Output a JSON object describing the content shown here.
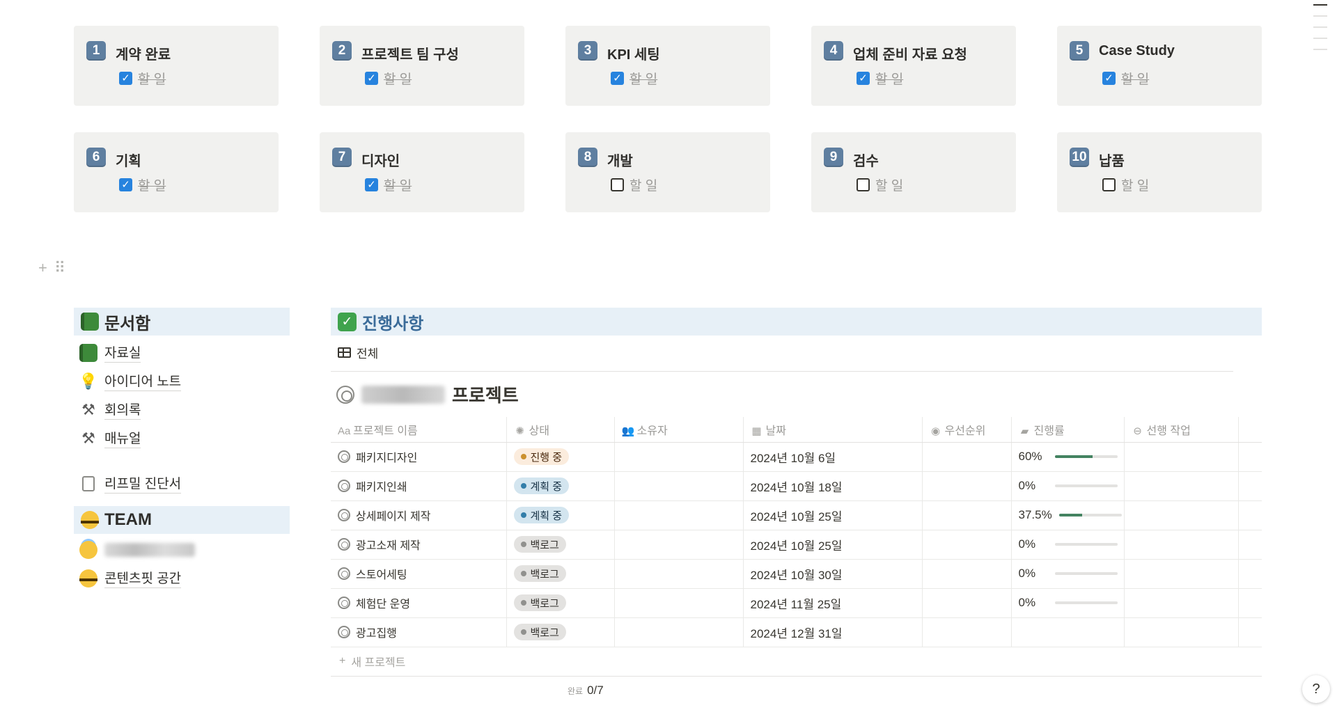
{
  "steps": [
    {
      "num": "1",
      "title": "계약 완료",
      "todo": "할 일",
      "done": true
    },
    {
      "num": "2",
      "title": "프로젝트 팀 구성",
      "todo": "할 일",
      "done": true
    },
    {
      "num": "3",
      "title": "KPI 세팅",
      "todo": "할 일",
      "done": true
    },
    {
      "num": "4",
      "title": "업체 준비 자료 요청",
      "todo": "할 일",
      "done": true
    },
    {
      "num": "5",
      "title": "Case Study",
      "todo": "할 일",
      "done": true
    },
    {
      "num": "6",
      "title": "기획",
      "todo": "할 일",
      "done": true
    },
    {
      "num": "7",
      "title": "디자인",
      "todo": "할 일",
      "done": true
    },
    {
      "num": "8",
      "title": "개발",
      "todo": "할 일",
      "done": false
    },
    {
      "num": "9",
      "title": "검수",
      "todo": "할 일",
      "done": false
    },
    {
      "num": "10",
      "title": "납품",
      "todo": "할 일",
      "done": false
    }
  ],
  "left": {
    "docs_heading": "문서함",
    "docs_items": [
      {
        "icon": "book",
        "label": "자료실"
      },
      {
        "icon": "bulb",
        "label": "아이디어 노트"
      },
      {
        "icon": "tools",
        "label": "회의록"
      },
      {
        "icon": "tools",
        "label": "매뉴얼"
      }
    ],
    "doc_page": "리프밀 진단서",
    "team_heading": "TEAM",
    "team_items": [
      {
        "icon": "halo",
        "label": ""
      },
      {
        "icon": "face",
        "label": "콘텐츠핏 공간"
      }
    ]
  },
  "progress": {
    "heading": "진행사항",
    "view_tab": "전체",
    "db_title": "프로젝트",
    "columns": [
      {
        "icon": "Aa",
        "label": "프로젝트 이름"
      },
      {
        "icon": "✺",
        "label": "상태"
      },
      {
        "icon": "👥",
        "label": "소유자"
      },
      {
        "icon": "▦",
        "label": "날짜"
      },
      {
        "icon": "◉",
        "label": "우선순위"
      },
      {
        "icon": "▰",
        "label": "진행률"
      },
      {
        "icon": "⊖",
        "label": "선행 작업"
      }
    ],
    "rows": [
      {
        "name": "패키지디자인",
        "status": "진행 중",
        "kind": "doing",
        "date": "2024년 10월 6일",
        "progress": "60%",
        "value": 60
      },
      {
        "name": "패키지인쇄",
        "status": "계획 중",
        "kind": "plan",
        "date": "2024년 10월 18일",
        "progress": "0%",
        "value": 0
      },
      {
        "name": "상세페이지 제작",
        "status": "계획 중",
        "kind": "plan",
        "date": "2024년 10월 25일",
        "progress": "37.5%",
        "value": 37.5
      },
      {
        "name": "광고소재 제작",
        "status": "백로그",
        "kind": "back",
        "date": "2024년 10월 25일",
        "progress": "0%",
        "value": 0
      },
      {
        "name": "스토어세팅",
        "status": "백로그",
        "kind": "back",
        "date": "2024년 10월 30일",
        "progress": "0%",
        "value": 0
      },
      {
        "name": "체험단 운영",
        "status": "백로그",
        "kind": "back",
        "date": "2024년 11월 25일",
        "progress": "0%",
        "value": 0
      },
      {
        "name": "광고집행",
        "status": "백로그",
        "kind": "back",
        "date": "2024년 12월 31일",
        "progress": "",
        "value": null
      }
    ],
    "new_row": "새 프로젝트",
    "done_label": "완료",
    "done_value": "0/7"
  },
  "help": "?"
}
